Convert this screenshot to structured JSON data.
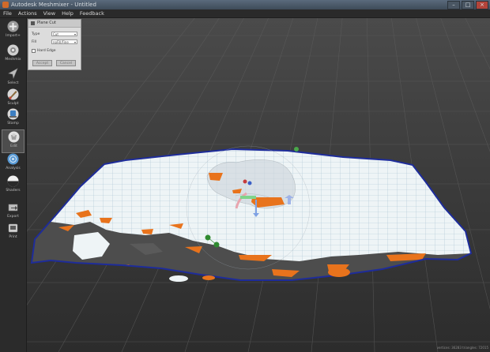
{
  "window": {
    "title": "Autodesk Meshmixer - Untitled",
    "controls": [
      "–",
      "□",
      "×"
    ]
  },
  "menu": [
    "File",
    "Actions",
    "View",
    "Help",
    "Feedback"
  ],
  "toolbar": [
    {
      "label": "Import+",
      "icon": "plus-icon"
    },
    {
      "label": "Meshmix",
      "icon": "meshmix-icon"
    },
    {
      "label": "Select",
      "icon": "select-arrow-icon"
    },
    {
      "label": "Sculpt",
      "icon": "sculpt-brush-icon"
    },
    {
      "label": "Stamp",
      "icon": "stamp-icon"
    },
    {
      "label": "Edit",
      "icon": "edit-icon"
    },
    {
      "label": "Analysis",
      "icon": "analysis-icon"
    },
    {
      "label": "Shaders",
      "icon": "shaders-icon"
    },
    {
      "label": "Export",
      "icon": "export-icon"
    },
    {
      "label": "Print",
      "icon": "print-icon"
    }
  ],
  "panel": {
    "title": "Plane Cut",
    "type_label": "Type",
    "type_value": "Cut",
    "fill_label": "Fill",
    "fill_value": "noFill/Fine",
    "checkbox_label": "Hard Edge",
    "accept_label": "Accept",
    "cancel_label": "Cancel"
  },
  "status": "vertices: 36283  triangles: 72015",
  "colors": {
    "background": "#3a3a3a",
    "mesh": "#eef4f6",
    "boundary": "#1e2c9a",
    "highlight": "#e8731c",
    "cavity": "#4d4d4d"
  }
}
